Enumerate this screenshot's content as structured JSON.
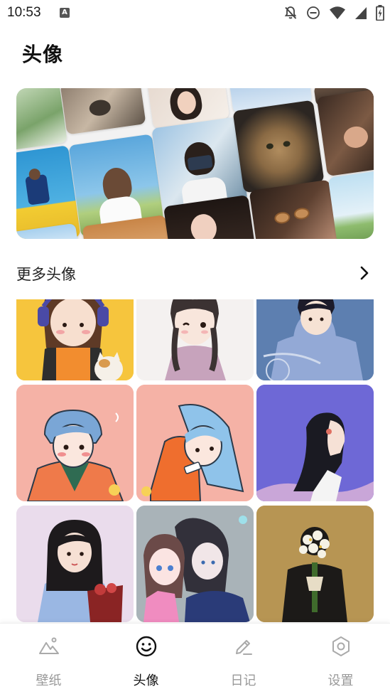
{
  "status_bar": {
    "time": "10:53",
    "app_icon": "A",
    "icons": [
      "notifications-off-icon",
      "do-not-disturb-icon",
      "wifi-icon",
      "cell-signal-icon",
      "battery-icon"
    ]
  },
  "page": {
    "title": "头像"
  },
  "banner": {
    "photos": [
      "fern-photo",
      "cat-photo",
      "girl-photo",
      "sky-photo",
      "curly-hair-photo",
      "running-man-photo",
      "braided-girl-photo",
      "camera-girl-photo",
      "tabby-cat-photo",
      "hat-woman-photo",
      "blue-sky-photo",
      "sunglasses-woman-photo",
      "hillside-photo",
      "dark-hair-girl-photo",
      "orange-cat-photo"
    ]
  },
  "more_section": {
    "title": "更多头像",
    "arrow_icon": "chevron-right-icon"
  },
  "avatars": [
    {
      "name": "girl-headphones-cat",
      "bg": "#f6c53d"
    },
    {
      "name": "girl-braids-wink",
      "bg": "#f4f1f0"
    },
    {
      "name": "boy-blue-hoodie-bike",
      "bg": "#5d7fb0"
    },
    {
      "name": "boy-orange-jacket",
      "bg": "#f5b2a6"
    },
    {
      "name": "girl-blue-hair-orange-coat",
      "bg": "#f5b2a6"
    },
    {
      "name": "girl-profile-purple",
      "bg": "#6e68d6"
    },
    {
      "name": "girl-blue-dress-flowers",
      "bg": "#eadcec"
    },
    {
      "name": "anime-couple",
      "bg": "#a9b3b8"
    },
    {
      "name": "man-flower-bouquet",
      "bg": "#b79553"
    }
  ],
  "bottom_nav": {
    "items": [
      {
        "label": "壁纸",
        "icon": "wallpaper-icon",
        "active": false
      },
      {
        "label": "头像",
        "icon": "smiley-icon",
        "active": true
      },
      {
        "label": "日记",
        "icon": "pencil-icon",
        "active": false
      },
      {
        "label": "设置",
        "icon": "settings-icon",
        "active": false
      }
    ],
    "active_color": "#111111",
    "inactive_color": "#999999"
  }
}
